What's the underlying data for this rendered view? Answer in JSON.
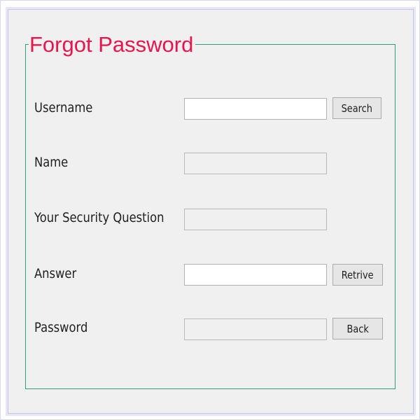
{
  "form": {
    "title": "Forgot Password",
    "username_label": "Username",
    "username_value": "",
    "search_label": "Search",
    "name_label": "Name",
    "name_value": "",
    "security_question_label": "Your Security Question",
    "security_question_value": "",
    "answer_label": "Answer",
    "answer_value": "",
    "retrive_label": "Retrive",
    "password_label": "Password",
    "password_value": "",
    "back_label": "Back"
  },
  "colors": {
    "title": "#e8164c",
    "group_border": "#2e9f74",
    "window_background": "#f0f0f0"
  }
}
